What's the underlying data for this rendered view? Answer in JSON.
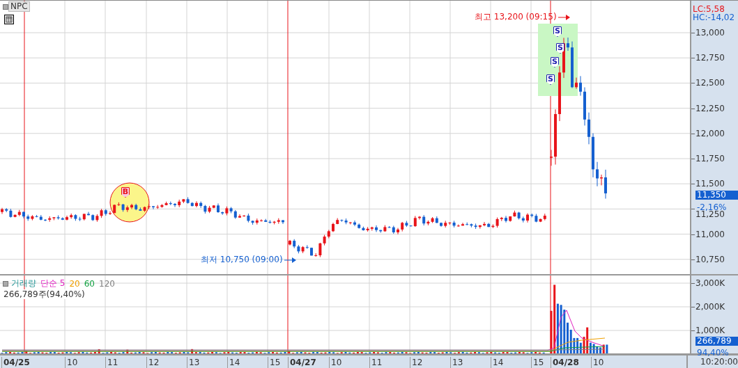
{
  "symbol": "NPC",
  "price_axis": {
    "lc": "LC:5,58",
    "hc": "HC:-14,02",
    "ticks": [
      "13,000",
      "12,750",
      "12,500",
      "12,250",
      "12,000",
      "11,750",
      "11,500",
      "11,250",
      "11,000",
      "10,750"
    ],
    "current": "11,350",
    "change": "-2,16%"
  },
  "annotations": [
    {
      "kind": "high",
      "text": "최고 13,200 (09:15)"
    },
    {
      "kind": "low",
      "text": "최저 10,750 (09:00)"
    }
  ],
  "markers": [
    {
      "kind": "buy",
      "label": "B"
    },
    {
      "kind": "sell",
      "label": "S"
    },
    {
      "kind": "sell",
      "label": "S"
    },
    {
      "kind": "sell",
      "label": "S"
    },
    {
      "kind": "sell",
      "label": "S"
    }
  ],
  "volume": {
    "legend": [
      {
        "text": "거래량",
        "color": "#2e9a9a"
      },
      {
        "text": "단순 5",
        "color": "#e020c0"
      },
      {
        "text": "20",
        "color": "#f0a000"
      },
      {
        "text": "60",
        "color": "#10a040"
      },
      {
        "text": "120",
        "color": "#808080"
      }
    ],
    "readout": "266,789주(94,40%)",
    "ticks": [
      "3,000K",
      "2,000K",
      "1,000K"
    ],
    "current": "266,789",
    "ratio": "94,40%"
  },
  "x_axis": [
    {
      "kind": "date",
      "text": "04/25"
    },
    {
      "kind": "hour",
      "text": "10"
    },
    {
      "kind": "hour",
      "text": "11"
    },
    {
      "kind": "hour",
      "text": "12"
    },
    {
      "kind": "hour",
      "text": "13"
    },
    {
      "kind": "hour",
      "text": "14"
    },
    {
      "kind": "hour",
      "text": "15"
    },
    {
      "kind": "date",
      "text": "04/27"
    },
    {
      "kind": "hour",
      "text": "10"
    },
    {
      "kind": "hour",
      "text": "11"
    },
    {
      "kind": "hour",
      "text": "12"
    },
    {
      "kind": "hour",
      "text": "13"
    },
    {
      "kind": "hour",
      "text": "14"
    },
    {
      "kind": "hour",
      "text": "15"
    },
    {
      "kind": "date",
      "text": "04/28"
    },
    {
      "kind": "hour",
      "text": "10"
    }
  ],
  "time": "10:20:00"
}
